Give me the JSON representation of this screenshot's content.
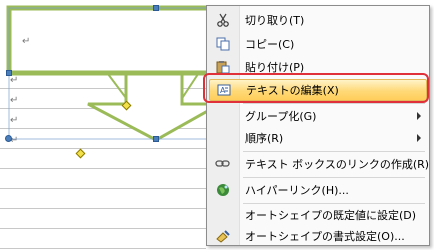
{
  "document": {
    "paragraph_mark": "↵"
  },
  "context_menu": {
    "items": [
      {
        "label": "切り取り(T)",
        "icon": "scissors-icon"
      },
      {
        "label": "コピー(C)",
        "icon": "copy-icon"
      },
      {
        "label": "貼り付け(P)",
        "icon": "paste-icon"
      },
      {
        "label": "テキストの編集(X)",
        "icon": "text-box-icon",
        "selected": true
      },
      {
        "label": "グループ化(G)",
        "icon": "",
        "submenu": true
      },
      {
        "label": "順序(R)",
        "icon": "",
        "submenu": true
      },
      {
        "label": "テキスト ボックスのリンクの作成(R)",
        "icon": "chain-link-icon"
      },
      {
        "label": "ハイパーリンク(H)...",
        "icon": "globe-icon"
      },
      {
        "label": "オートシェイプの既定値に設定(D)",
        "icon": ""
      },
      {
        "label": "オートシェイプの書式設定(O)...",
        "icon": "format-shape-icon"
      }
    ]
  },
  "colors": {
    "shape_outline": "#9bbb59",
    "shape_fill": "#ffffff",
    "highlight_ring": "#e0303a",
    "selection_handle": "#4a7ebb",
    "adjust_handle": "#f2e14a"
  }
}
